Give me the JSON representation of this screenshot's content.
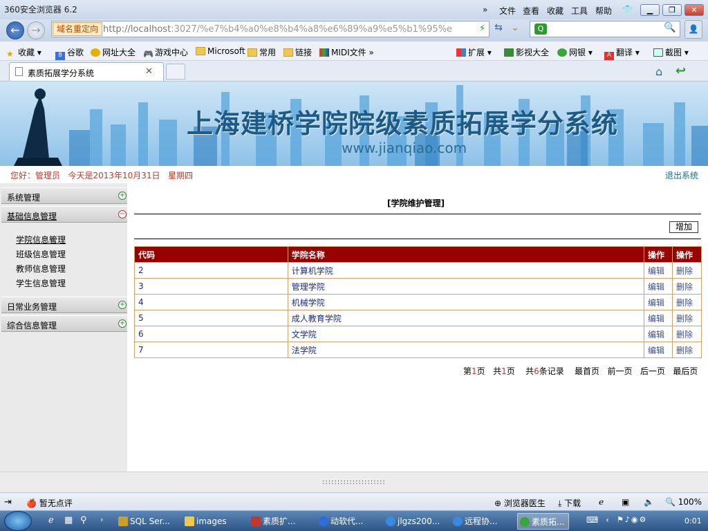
{
  "browser": {
    "title": "360安全浏览器 6.2",
    "menu": [
      "文件",
      "查看",
      "收藏",
      "工具",
      "帮助"
    ],
    "redirect_label": "域名重定向",
    "url_host": "http://localhost",
    "url_rest": ":3027/%e7%b4%a0%e8%b4%a8%e6%89%a9%e5%b1%95%e",
    "tab_title": "素质拓展学分系统",
    "bookmarks": [
      "收藏",
      "谷歌",
      "网址大全",
      "游戏中心",
      "Microsoft",
      "常用",
      "链接",
      "MIDI文件"
    ],
    "bookmarks_right": [
      "扩展",
      "影视大全",
      "网银",
      "翻译",
      "截图"
    ],
    "status_left": "暂无点评",
    "status_right": [
      "浏览器医生",
      "下载"
    ],
    "zoom": "100%"
  },
  "site": {
    "banner_title": "上海建桥学院院级素质拓展学分系统",
    "banner_url": "www.jianqiao.com",
    "greeting": "您好：管理员   今天是2013年10月31日   星期四",
    "logout": "退出系统"
  },
  "sidebar": {
    "sections": [
      {
        "label": "系统管理",
        "expanded": false
      },
      {
        "label": "基础信息管理",
        "expanded": true
      },
      {
        "label": "日常业务管理",
        "expanded": false
      },
      {
        "label": "综合信息管理",
        "expanded": false
      }
    ],
    "subitems": [
      "学院信息管理",
      "班级信息管理",
      "教师信息管理",
      "学生信息管理"
    ]
  },
  "main": {
    "title": "[学院维护管理]",
    "add_label": "增加",
    "columns": [
      "代码",
      "学院名称",
      "操作",
      "操作"
    ],
    "rows": [
      {
        "code": "2",
        "name": "计算机学院"
      },
      {
        "code": "3",
        "name": "管理学院"
      },
      {
        "code": "4",
        "name": "机械学院"
      },
      {
        "code": "5",
        "name": "成人教育学院"
      },
      {
        "code": "6",
        "name": "文学院"
      },
      {
        "code": "7",
        "name": "法学院"
      }
    ],
    "edit_label": "编辑",
    "delete_label": "删除",
    "pager": {
      "page_prefix": "第",
      "page_num": "1",
      "page_suffix": "页",
      "total_prefix": "共",
      "total_pages": "1",
      "total_suffix": "页",
      "rec_prefix": "共",
      "records": "6",
      "rec_suffix": "条记录",
      "first": "最首页",
      "prev": "前一页",
      "next": "后一页",
      "last": "最后页"
    }
  },
  "dots": ":::::::::::::::::::::",
  "taskbar": {
    "items": [
      "SQL Ser...",
      "images",
      "素质扩...",
      "动软代...",
      "jlgzs200...",
      "远程协...",
      "素质拓..."
    ],
    "clock": "0:01"
  },
  "colors": {
    "header": "#990000",
    "accent": "#c0392b",
    "link": "#1d2a7a"
  }
}
